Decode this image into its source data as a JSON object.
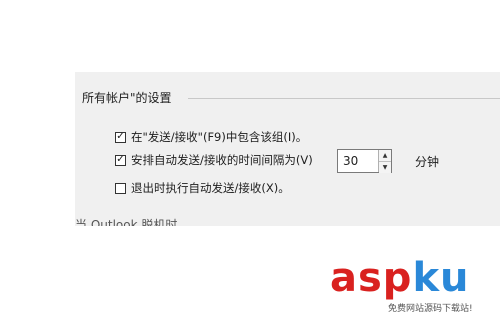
{
  "group": {
    "title": "所有帐户\"的设置"
  },
  "options": [
    {
      "label": "在\"发送/接收\"(F9)中包含该组(I)。",
      "checked": true
    },
    {
      "label": "安排自动发送/接收的时间间隔为(V)",
      "checked": true
    },
    {
      "label": "退出时执行自动发送/接收(X)。",
      "checked": false
    }
  ],
  "interval": {
    "value": "30",
    "unit": "分钟"
  },
  "section2": {
    "title": "当 Outlook 脱机时"
  },
  "watermark": {
    "brand_a": "asp",
    "brand_b": "ku",
    "tagline": "免费网站源码下载站!"
  }
}
